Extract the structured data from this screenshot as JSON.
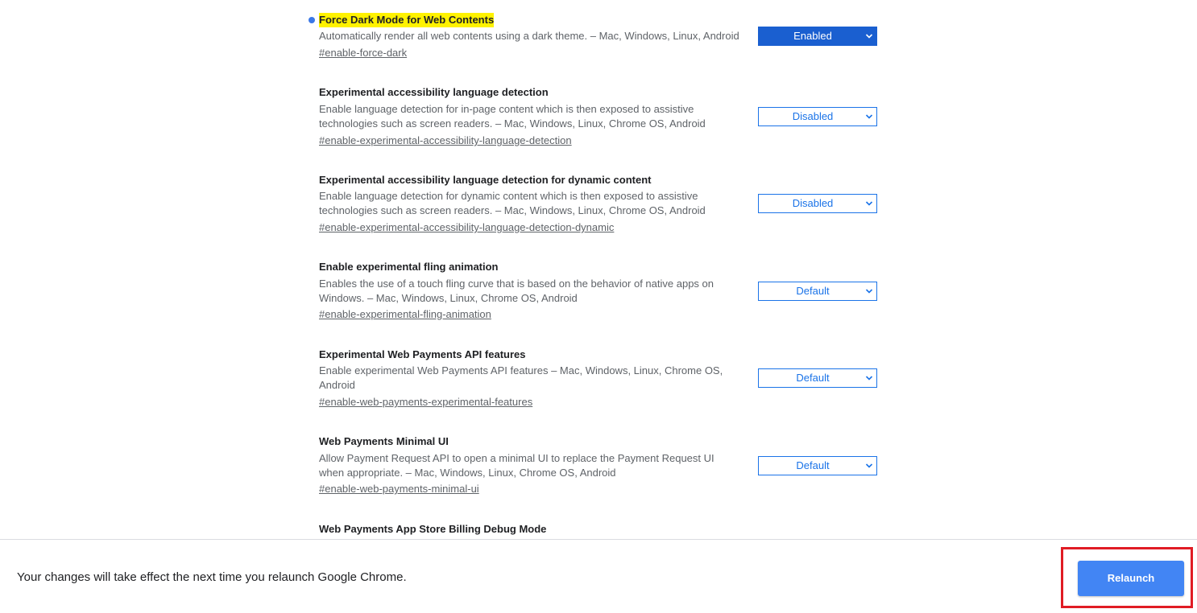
{
  "flags": [
    {
      "title": "Force Dark Mode for Web Contents",
      "description": "Automatically render all web contents using a dark theme. – Mac, Windows, Linux, Android",
      "link": "#enable-force-dark",
      "selected": "Enabled",
      "modified": true,
      "highlighted": true
    },
    {
      "title": "Experimental accessibility language detection",
      "description": "Enable language detection for in-page content which is then exposed to assistive technologies such as screen readers. – Mac, Windows, Linux, Chrome OS, Android",
      "link": "#enable-experimental-accessibility-language-detection",
      "selected": "Disabled"
    },
    {
      "title": "Experimental accessibility language detection for dynamic content",
      "description": "Enable language detection for dynamic content which is then exposed to assistive technologies such as screen readers. – Mac, Windows, Linux, Chrome OS, Android",
      "link": "#enable-experimental-accessibility-language-detection-dynamic",
      "selected": "Disabled"
    },
    {
      "title": "Enable experimental fling animation",
      "description": "Enables the use of a touch fling curve that is based on the behavior of native apps on Windows. – Mac, Windows, Linux, Chrome OS, Android",
      "link": "#enable-experimental-fling-animation",
      "selected": "Default"
    },
    {
      "title": "Experimental Web Payments API features",
      "description": "Enable experimental Web Payments API features – Mac, Windows, Linux, Chrome OS, Android",
      "link": "#enable-web-payments-experimental-features",
      "selected": "Default"
    },
    {
      "title": "Web Payments Minimal UI",
      "description": "Allow Payment Request API to open a minimal UI to replace the Payment Request UI when appropriate. – Mac, Windows, Linux, Chrome OS, Android",
      "link": "#enable-web-payments-minimal-ui",
      "selected": "Default"
    },
    {
      "title": "Web Payments App Store Billing Debug Mode"
    }
  ],
  "bottom_bar": {
    "notice": "Your changes will take effect the next time you relaunch Google Chrome.",
    "relaunch_label": "Relaunch"
  },
  "colors": {
    "accent": "#1a73e8",
    "enabled_select": "#1a5fd0",
    "relaunch_button": "#4285f4",
    "highlight": "#fff200",
    "focus_outline": "#e01c24"
  },
  "icons": {
    "modified_indicator": "blue-dot-icon",
    "select_arrow": "chevron-down-icon"
  }
}
